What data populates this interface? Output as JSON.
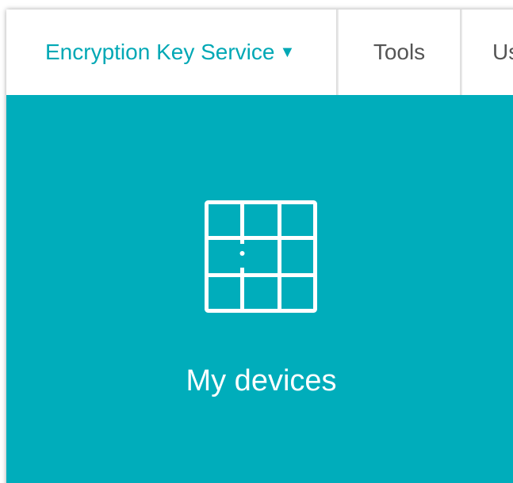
{
  "nav": {
    "primary_label": "Encryption Key Service",
    "primary_caret": "▼",
    "items": [
      {
        "label": "Tools"
      },
      {
        "label": "Us"
      }
    ]
  },
  "tile": {
    "label": "My devices",
    "icon": "device-grid-icon"
  },
  "colors": {
    "accent": "#00a8b5",
    "tile_background": "#00adbb",
    "nav_text": "#555555",
    "tile_text": "#ffffff"
  }
}
